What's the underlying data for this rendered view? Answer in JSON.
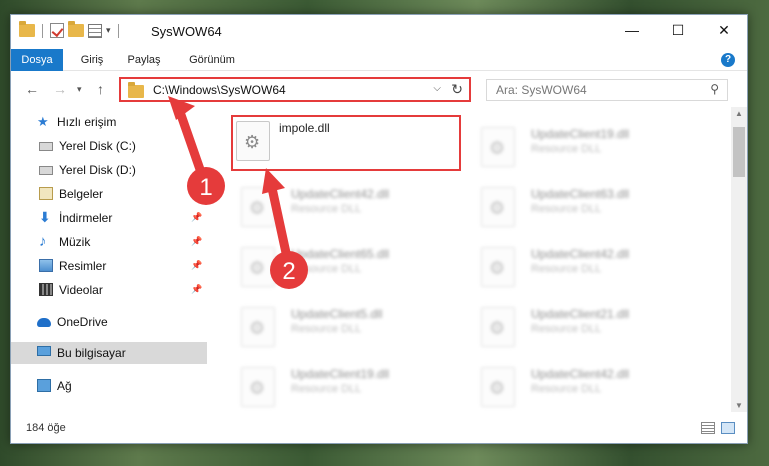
{
  "window": {
    "title": "SysWOW64",
    "controls": {
      "minimize": "—",
      "maximize": "☐",
      "close": "✕"
    }
  },
  "quick_access_toolbar": {
    "dropdown": "▾"
  },
  "ribbon": {
    "tabs": [
      {
        "label": "Dosya",
        "active": true
      },
      {
        "label": "Giriş"
      },
      {
        "label": "Paylaş"
      },
      {
        "label": "Görünüm"
      }
    ],
    "help": "?"
  },
  "nav": {
    "back": "←",
    "forward": "→",
    "recent": "▾",
    "up": "↑",
    "address": "C:\\Windows\\SysWOW64",
    "address_dropdown": "⌵",
    "refresh": "↻",
    "search_placeholder": "Ara: SysWOW64",
    "search_icon": "⚲"
  },
  "sidebar": {
    "items": [
      {
        "label": "Hızlı erişim",
        "icon": "star-icon"
      },
      {
        "label": "Yerel Disk (C:)",
        "icon": "disk-icon"
      },
      {
        "label": "Yerel Disk (D:)",
        "icon": "disk-icon"
      },
      {
        "label": "Belgeler",
        "icon": "documents-icon"
      },
      {
        "label": "İndirmeler",
        "icon": "download-icon",
        "pinned": true
      },
      {
        "label": "Müzik",
        "icon": "music-icon",
        "pinned": true
      },
      {
        "label": "Resimler",
        "icon": "pictures-icon",
        "pinned": true
      },
      {
        "label": "Videolar",
        "icon": "videos-icon",
        "pinned": true
      },
      {
        "label": "OneDrive",
        "icon": "onedrive-icon"
      },
      {
        "label": "Bu bilgisayar",
        "icon": "computer-icon",
        "selected": true
      },
      {
        "label": "Ağ",
        "icon": "network-icon"
      }
    ],
    "pin_glyph": "📌"
  },
  "files": [
    {
      "name": "impole.dll",
      "type": "",
      "highlighted": true
    },
    {
      "name": "UpdateClient19.dll",
      "type": "Resource DLL"
    },
    {
      "name": "UpdateClient42.dll",
      "type": "Resource DLL"
    },
    {
      "name": "UpdateClient63.dll",
      "type": "Resource DLL"
    },
    {
      "name": "UpdateClient65.dll",
      "type": "Resource DLL"
    },
    {
      "name": "UpdateClient42.dll",
      "type": "Resource DLL"
    },
    {
      "name": "UpdateClient5.dll",
      "type": "Resource DLL"
    },
    {
      "name": "UpdateClient21.dll",
      "type": "Resource DLL"
    },
    {
      "name": "UpdateClient19.dll",
      "type": "Resource DLL"
    },
    {
      "name": "UpdateClient42.dll",
      "type": "Resource DLL"
    }
  ],
  "status": {
    "item_count": "184 öğe"
  },
  "annotations": {
    "step1": "1",
    "step2": "2",
    "accent": "#e53b3b"
  }
}
